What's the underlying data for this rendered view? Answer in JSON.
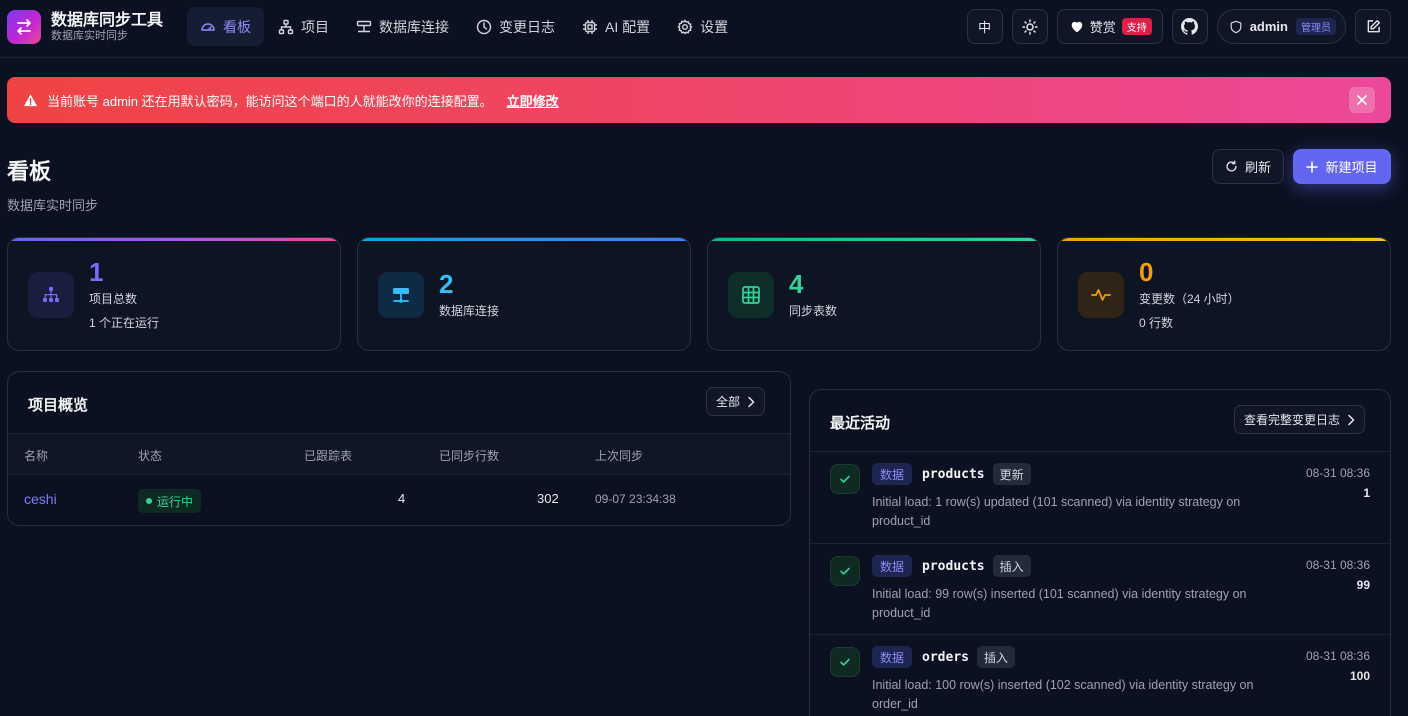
{
  "app": {
    "title": "数据库同步工具",
    "subtitle": "数据库实时同步"
  },
  "nav": {
    "items": [
      {
        "label": "看板",
        "icon": "dashboard-icon",
        "active": true
      },
      {
        "label": "项目",
        "icon": "sitemap-icon"
      },
      {
        "label": "数据库连接",
        "icon": "server-icon"
      },
      {
        "label": "变更日志",
        "icon": "clock-icon"
      },
      {
        "label": "AI 配置",
        "icon": "chip-icon"
      },
      {
        "label": "设置",
        "icon": "gear-icon"
      }
    ]
  },
  "topbar": {
    "lang": "中",
    "sponsor_label": "赞赏",
    "sponsor_badge": "支持",
    "user_name": "admin",
    "user_role": "管理员"
  },
  "alert": {
    "message": "当前账号 admin 还在用默认密码，能访问这个端口的人就能改你的连接配置。",
    "link": "立即修改"
  },
  "header": {
    "title": "看板",
    "subtitle": "数据库实时同步",
    "refresh_label": "刷新",
    "new_label": "新建项目"
  },
  "stats": [
    {
      "value": "1",
      "label": "项目总数",
      "sub": "1 个正在运行",
      "color": "#7c6cf5"
    },
    {
      "value": "2",
      "label": "数据库连接",
      "sub": "",
      "color": "#38bdf8"
    },
    {
      "value": "4",
      "label": "同步表数",
      "sub": "",
      "color": "#34d399"
    },
    {
      "value": "0",
      "label": "变更数（24 小时）",
      "sub": "0 行数",
      "color": "#f59e0b"
    }
  ],
  "projects": {
    "title": "项目概览",
    "all_label": "全部",
    "columns": [
      "名称",
      "状态",
      "已跟踪表",
      "已同步行数",
      "上次同步"
    ],
    "rows": [
      {
        "name": "ceshi",
        "status": "运行中",
        "tables": "4",
        "rows": "302",
        "last_sync": "09-07 23:34:38"
      }
    ]
  },
  "activity": {
    "title": "最近活动",
    "view_all_label": "查看完整变更日志",
    "items": [
      {
        "type": "数据",
        "table": "products",
        "op": "更新",
        "message": "Initial load: 1 row(s) updated (101 scanned) via identity strategy on product_id",
        "time": "08-31 08:36",
        "count": "1"
      },
      {
        "type": "数据",
        "table": "products",
        "op": "插入",
        "message": "Initial load: 99 row(s) inserted (101 scanned) via identity strategy on product_id",
        "time": "08-31 08:36",
        "count": "99"
      },
      {
        "type": "数据",
        "table": "orders",
        "op": "插入",
        "message": "Initial load: 100 row(s) inserted (102 scanned) via identity strategy on order_id",
        "time": "08-31 08:36",
        "count": "100"
      }
    ]
  }
}
